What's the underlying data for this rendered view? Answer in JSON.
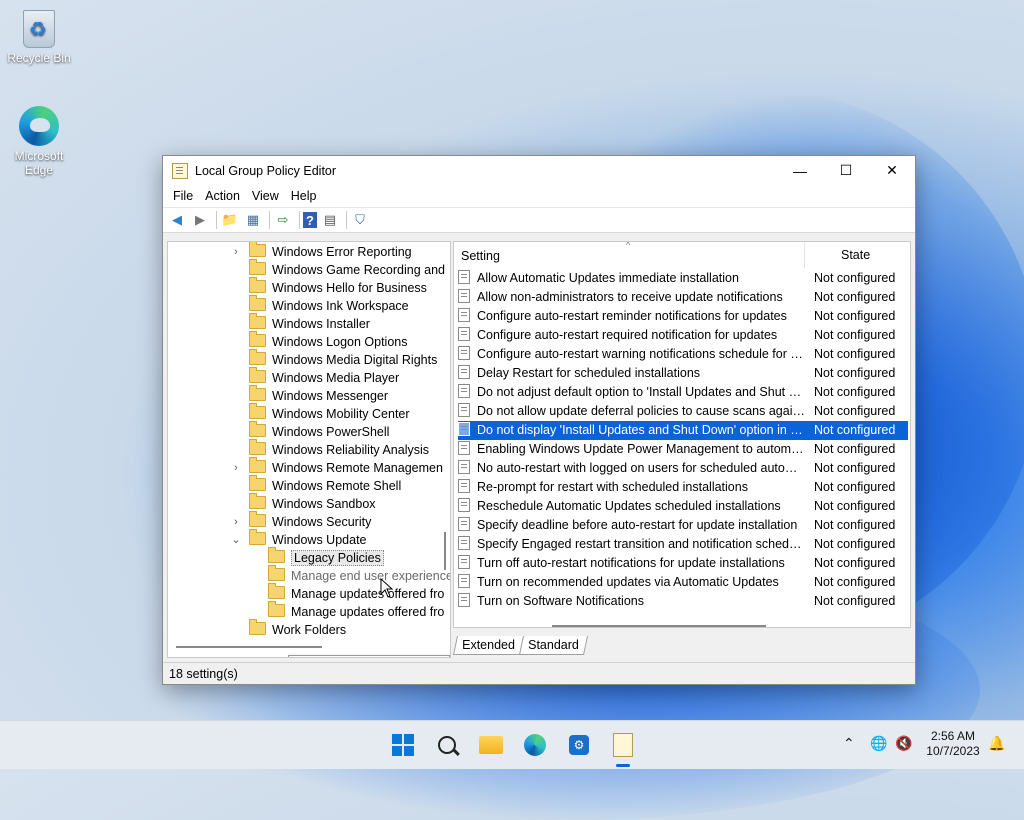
{
  "desktop": {
    "icons": [
      {
        "label": "Recycle Bin"
      },
      {
        "label": "Microsoft Edge"
      }
    ]
  },
  "window": {
    "title": "Local Group Policy Editor",
    "controls": {
      "minimize": "—",
      "maximize": "☐",
      "close": "✕"
    },
    "menu": [
      "File",
      "Action",
      "View",
      "Help"
    ],
    "toolbar": {
      "back": "◀",
      "forward": "▶",
      "up": "📁",
      "show_hide": "▦",
      "export": "⇨",
      "help": "?",
      "properties": "▤",
      "filter": "⛉"
    },
    "tree": [
      {
        "label": "Windows Error Reporting",
        "expandable": true
      },
      {
        "label": "Windows Game Recording and",
        "expandable": false
      },
      {
        "label": "Windows Hello for Business",
        "expandable": false
      },
      {
        "label": "Windows Ink Workspace",
        "expandable": false
      },
      {
        "label": "Windows Installer",
        "expandable": false
      },
      {
        "label": "Windows Logon Options",
        "expandable": false
      },
      {
        "label": "Windows Media Digital Rights",
        "expandable": false
      },
      {
        "label": "Windows Media Player",
        "expandable": false
      },
      {
        "label": "Windows Messenger",
        "expandable": false
      },
      {
        "label": "Windows Mobility Center",
        "expandable": false
      },
      {
        "label": "Windows PowerShell",
        "expandable": false
      },
      {
        "label": "Windows Reliability Analysis",
        "expandable": false
      },
      {
        "label": "Windows Remote Managemen",
        "expandable": true
      },
      {
        "label": "Windows Remote Shell",
        "expandable": false
      },
      {
        "label": "Windows Sandbox",
        "expandable": false
      },
      {
        "label": "Windows Security",
        "expandable": true
      },
      {
        "label": "Windows Update",
        "expandable": "open"
      },
      {
        "label": "Legacy Policies",
        "child": true,
        "selected": true
      },
      {
        "label": "Manage end user experience",
        "child": true,
        "muted": true
      },
      {
        "label": "Manage updates offered fro",
        "child": true
      },
      {
        "label": "Manage updates offered fro",
        "child": true
      },
      {
        "label": "Work Folders",
        "expandable": false
      }
    ],
    "tooltip": "Manage end user experience",
    "expander": {
      "closed": "›",
      "open": "⌄"
    },
    "list": {
      "headers": {
        "setting": "Setting",
        "state": "State",
        "sort": "^"
      },
      "rows": [
        {
          "name": "Allow Automatic Updates immediate installation",
          "state": "Not configured"
        },
        {
          "name": "Allow non-administrators to receive update notifications",
          "state": "Not configured"
        },
        {
          "name": "Configure auto-restart reminder notifications for updates",
          "state": "Not configured"
        },
        {
          "name": "Configure auto-restart required notification for updates",
          "state": "Not configured"
        },
        {
          "name": "Configure auto-restart warning notifications schedule for u...",
          "state": "Not configured"
        },
        {
          "name": "Delay Restart for scheduled installations",
          "state": "Not configured"
        },
        {
          "name": "Do not adjust default option to 'Install Updates and Shut Do...",
          "state": "Not configured"
        },
        {
          "name": "Do not allow update deferral policies to cause scans against ...",
          "state": "Not configured"
        },
        {
          "name": "Do not display 'Install Updates and Shut Down' option in Sh...",
          "state": "Not configured",
          "selected": true
        },
        {
          "name": "Enabling Windows Update Power Management to automati...",
          "state": "Not configured"
        },
        {
          "name": "No auto-restart with logged on users for scheduled automat...",
          "state": "Not configured"
        },
        {
          "name": "Re-prompt for restart with scheduled installations",
          "state": "Not configured"
        },
        {
          "name": "Reschedule Automatic Updates scheduled installations",
          "state": "Not configured"
        },
        {
          "name": "Specify deadline before auto-restart for update installation",
          "state": "Not configured"
        },
        {
          "name": "Specify Engaged restart transition and notification schedule ...",
          "state": "Not configured"
        },
        {
          "name": "Turn off auto-restart notifications for update installations",
          "state": "Not configured"
        },
        {
          "name": "Turn on recommended updates via Automatic Updates",
          "state": "Not configured"
        },
        {
          "name": "Turn on Software Notifications",
          "state": "Not configured"
        }
      ]
    },
    "tabs": [
      "Extended",
      "Standard"
    ],
    "status": "18 setting(s)"
  },
  "taskbar": {
    "tray_chevron": "⌃",
    "tray_globe": "🌐",
    "tray_volume": "🔇",
    "clock_time": "2:56 AM",
    "clock_date": "10/7/2023",
    "notif": "🔔"
  }
}
